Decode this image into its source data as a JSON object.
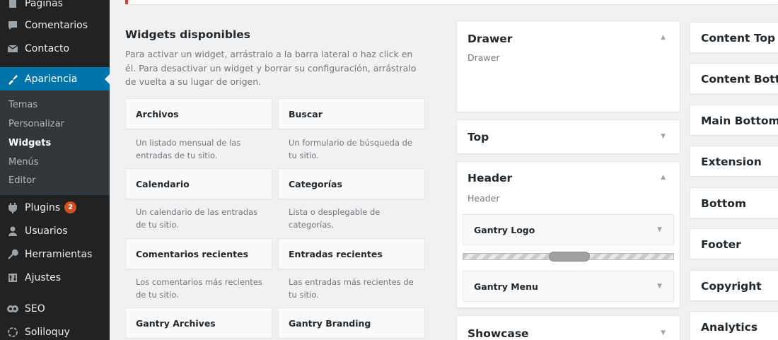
{
  "sidebar": {
    "items": [
      {
        "label": "Páginas",
        "icon": "pages-icon"
      },
      {
        "label": "Comentarios",
        "icon": "comments-icon"
      },
      {
        "label": "Contacto",
        "icon": "mail-icon"
      },
      {
        "label": "Apariencia",
        "icon": "appearance-icon"
      },
      {
        "label": "Plugins",
        "icon": "plugins-icon",
        "badge": "2"
      },
      {
        "label": "Usuarios",
        "icon": "users-icon"
      },
      {
        "label": "Herramientas",
        "icon": "tools-icon"
      },
      {
        "label": "Ajustes",
        "icon": "settings-icon"
      },
      {
        "label": "SEO",
        "icon": "seo-icon"
      },
      {
        "label": "Soliloquy",
        "icon": "soliloquy-icon"
      }
    ],
    "submenu": [
      "Temas",
      "Personalizar",
      "Widgets",
      "Menús",
      "Editor"
    ]
  },
  "available": {
    "title": "Widgets disponibles",
    "description": "Para activar un widget, arrástralo a la barra lateral o haz click en él. Para desactivar un widget y borrar su configuración, arrástralo de vuelta a su lugar de origen.",
    "widgets": [
      {
        "name": "Archivos",
        "desc": "Un listado mensual de las entradas de tu sitio."
      },
      {
        "name": "Buscar",
        "desc": "Un formulario de búsqueda de tu sitio."
      },
      {
        "name": "Calendario",
        "desc": "Un calendario de las entradas de tu sitio."
      },
      {
        "name": "Categorías",
        "desc": "Lista o desplegable de categorías."
      },
      {
        "name": "Comentarios recientes",
        "desc": "Los comentarios más recientes de tu sitio."
      },
      {
        "name": "Entradas recientes",
        "desc": "Las entradas más recientes de tu sitio."
      },
      {
        "name": "Gantry Archives",
        "desc": ""
      },
      {
        "name": "Gantry Branding",
        "desc": ""
      }
    ]
  },
  "areas": {
    "drawer": {
      "title": "Drawer",
      "sub": "Drawer"
    },
    "top": {
      "title": "Top"
    },
    "header": {
      "title": "Header",
      "sub": "Header",
      "widgets": [
        "Gantry Logo",
        "Gantry Menu"
      ]
    },
    "showcase": {
      "title": "Showcase"
    }
  },
  "right_areas": [
    "Content Top",
    "Content Bottom",
    "Main Bottom",
    "Extension",
    "Bottom",
    "Footer",
    "Copyright",
    "Analytics"
  ],
  "icons": {
    "arrow_up": "▲",
    "arrow_down": "▼"
  }
}
